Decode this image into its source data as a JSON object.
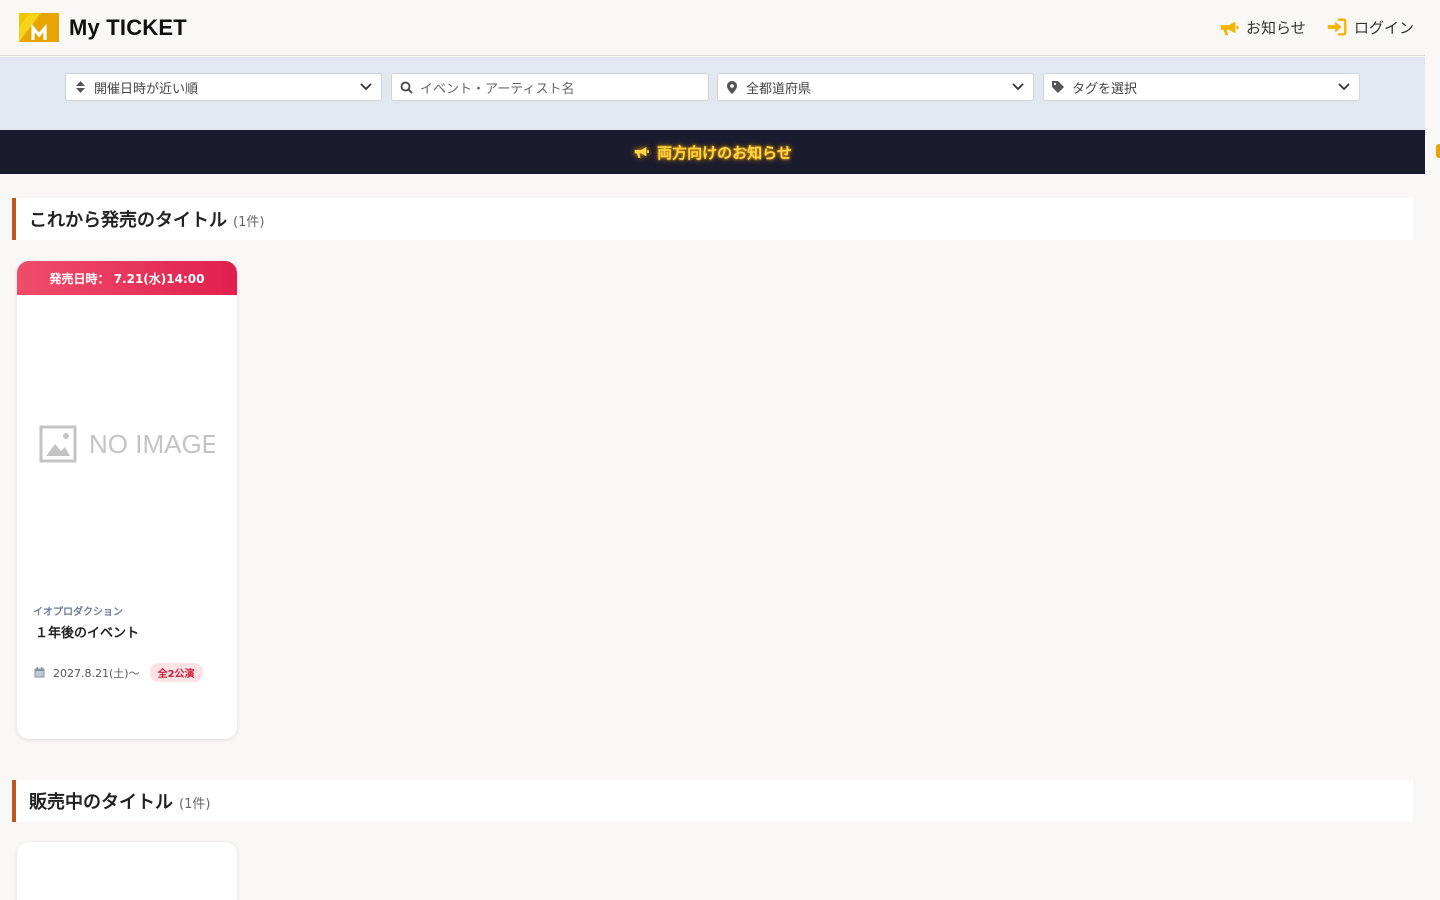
{
  "header": {
    "brand": "My TICKET",
    "nav": {
      "news": "お知らせ",
      "login": "ログイン"
    },
    "accent": "#f5b300"
  },
  "filters": {
    "sort": "開催日時が近い順",
    "search_placeholder": "イベント・アーティスト名",
    "prefecture": "全都道府県",
    "tag": "タグを選択"
  },
  "banner": {
    "text": "両方向けのお知らせ",
    "icon": "megaphone-icon"
  },
  "sections": [
    {
      "title": "これから発売のタイトル",
      "count": "(1件)",
      "cards": [
        {
          "sale_label": "発売日時： 7.21(水)14:00",
          "image_text": "NO IMAGE",
          "organizer": "イオプロダクション",
          "title": "１年後のイベント",
          "date": "2027.8.21(土)〜",
          "shows": "全2公演"
        }
      ]
    },
    {
      "title": "販売中のタイトル",
      "count": "(1件)"
    }
  ]
}
